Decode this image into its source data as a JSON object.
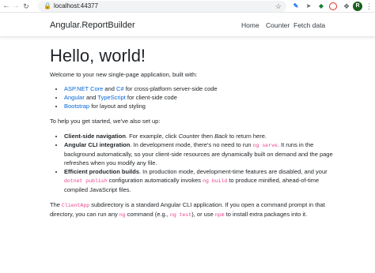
{
  "browser": {
    "url": "localhost:44377",
    "avatar_initial": "R"
  },
  "navbar": {
    "brand": "Angular.ReportBuilder",
    "links": [
      "Home",
      "Counter",
      "Fetch data"
    ]
  },
  "main": {
    "heading": "Hello, world!",
    "intro": "Welcome to your new single-page application, built with:",
    "built_with": [
      {
        "links": [
          "ASP.NET Core",
          "C#"
        ],
        "joiner": " and ",
        "suffix": " for cross-platform server-side code"
      },
      {
        "links": [
          "Angular",
          "TypeScript"
        ],
        "joiner": " and ",
        "suffix": " for client-side code"
      },
      {
        "links": [
          "Bootstrap"
        ],
        "joiner": "",
        "suffix": " for layout and styling"
      }
    ],
    "setup_intro": "To help you get started, we've also set up:",
    "setup_items": [
      {
        "title": "Client-side navigation",
        "text_a": ". For example, click ",
        "em1": "Counter",
        "text_b": " then ",
        "em2": "Back",
        "text_c": " to return here."
      },
      {
        "title": "Angular CLI integration",
        "text_a": ". In development mode, there's no need to run ",
        "code": "ng serve",
        "text_b": ". It runs in the background automatically, so your client-side resources are dynamically built on demand and the page refreshes when you modify any file."
      },
      {
        "title": "Efficient production builds",
        "text_a": ". In production mode, development-time features are disabled, and your ",
        "code1": "dotnet publish",
        "text_b": " configuration automatically invokes ",
        "code2": "ng build",
        "text_c": " to produce minified, ahead-of-time compiled JavaScript files."
      }
    ],
    "clientapp": {
      "text_a": "The ",
      "code1": "ClientApp",
      "text_b": " subdirectory is a standard Angular CLI application. If you open a command prompt in that directory, you can run any ",
      "code2": "ng",
      "text_c": " command (e.g., ",
      "code3": "ng test",
      "text_d": "), or use ",
      "code4": "npm",
      "text_e": " to install extra packages into it."
    }
  },
  "colors": {
    "link": "#0366d6",
    "code": "#e83e8c",
    "text": "#212529"
  }
}
